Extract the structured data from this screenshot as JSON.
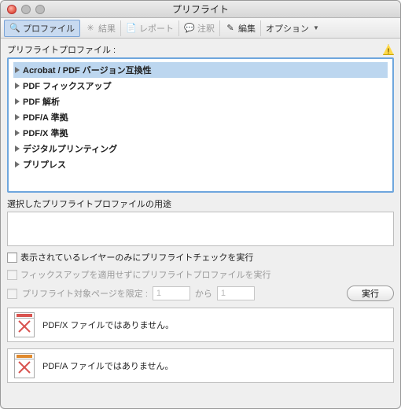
{
  "window": {
    "title": "プリフライト"
  },
  "toolbar": {
    "items": [
      {
        "label": "プロファイル",
        "active": true
      },
      {
        "label": "結果",
        "disabled": true
      },
      {
        "label": "レポート",
        "disabled": true
      },
      {
        "label": "注釈",
        "disabled": true
      },
      {
        "label": "編集"
      },
      {
        "label": "オプション",
        "dropdown": true
      }
    ]
  },
  "section_label": "プリフライトプロファイル :",
  "tree": {
    "items": [
      {
        "label": "Acrobat / PDF バージョン互換性",
        "selected": true
      },
      {
        "label": "PDF フィックスアップ"
      },
      {
        "label": "PDF 解析"
      },
      {
        "label": "PDF/A 準拠"
      },
      {
        "label": "PDF/X 準拠"
      },
      {
        "label": "デジタルプリンティング"
      },
      {
        "label": "プリプレス"
      }
    ]
  },
  "usage_label": "選択したプリフライトプロファイルの用途",
  "checks": {
    "c1": "表示されているレイヤーのみにプリフライトチェックを実行",
    "c2": "フィックスアップを適用せずにプリフライトプロファイルを実行",
    "range_label": "プリフライト対象ページを限定 :",
    "from": "1",
    "to_label": "から",
    "to": "1"
  },
  "run_button": "実行",
  "status": {
    "pdfx": "PDF/X ファイルではありません。",
    "pdfa": "PDF/A ファイルではありません。"
  }
}
